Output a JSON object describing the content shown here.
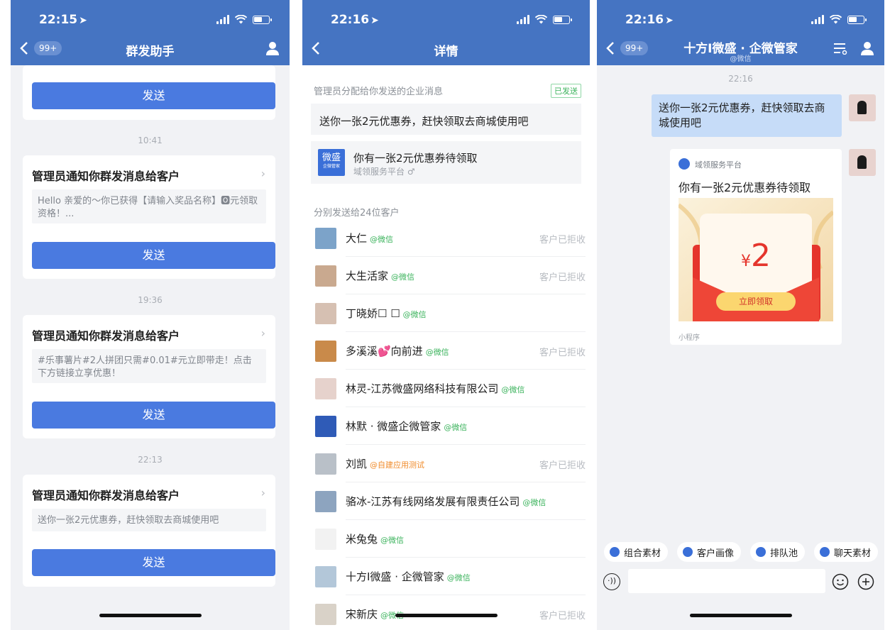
{
  "screen1": {
    "status_time": "22:15",
    "nav_badge": "99+",
    "nav_title": "群发助手",
    "send_label": "发送",
    "items": [
      {
        "time": "10:41",
        "title": "管理员通知你群发消息给客户",
        "preview": "Hello 亲爱的～你已获得【请输入奖品名称】🅾元领取资格！..."
      },
      {
        "time": "19:36",
        "title": "管理员通知你群发消息给客户",
        "preview": "#乐事薯片#2人拼团只需#0.01#元立即带走！点击下方链接立享优惠！"
      },
      {
        "time": "22:13",
        "title": "管理员通知你群发消息给客户",
        "preview": "送你一张2元优惠券，赶快领取去商城使用吧"
      }
    ]
  },
  "screen2": {
    "status_time": "22:16",
    "nav_title": "详情",
    "section_label": "管理员分配给你发送的企业消息",
    "sent_tag": "已发送",
    "message_text": "送你一张2元优惠券，赶快领取去商城使用吧",
    "mini_logo_line1": "微盛",
    "mini_logo_line2": "企微管家",
    "mini_title": "你有一张2元优惠券待领取",
    "mini_source": "域领服务平台",
    "customers_label": "分别发送给24位客户",
    "customers": [
      {
        "name": "大仁",
        "tag": "@微信",
        "status": "客户已拒收"
      },
      {
        "name": "大生活家",
        "tag": "@微信",
        "status": "客户已拒收"
      },
      {
        "name": "丁晓娇☐ ☐",
        "tag": "@微信",
        "status": ""
      },
      {
        "name": "多溪溪💕向前进",
        "tag": "@微信",
        "status": "客户已拒收"
      },
      {
        "name": "林灵-江苏微盛网络科技有限公司",
        "tag": "@微信",
        "status": ""
      },
      {
        "name": "林默 · 微盛企微管家",
        "tag": "@微信",
        "status": ""
      },
      {
        "name": "刘凯",
        "tag": "@自建应用测试",
        "status": "客户已拒收"
      },
      {
        "name": "骆冰-江苏有线网络发展有限责任公司",
        "tag": "@微信",
        "status": ""
      },
      {
        "name": "米兔兔",
        "tag": "@微信",
        "status": ""
      },
      {
        "name": "十方I微盛 · 企微管家",
        "tag": "@微信",
        "status": ""
      },
      {
        "name": "宋新庆",
        "tag": "@微信",
        "status": "客户已拒收"
      }
    ]
  },
  "screen3": {
    "status_time": "22:16",
    "nav_badge": "99+",
    "nav_title": "十方I微盛 · 企微管家",
    "nav_subtitle": "@微信",
    "chat_time": "22:16",
    "bubble_text": "送你一张2元优惠券，赶快领取去商城使用吧",
    "card_source": "域领服务平台",
    "card_title": "你有一张2元优惠券待领取",
    "coupon_amount": "2",
    "coupon_currency": "¥",
    "coupon_button": "立即领取",
    "card_footer": "小程序",
    "quick_actions": [
      "组合素材",
      "客户画像",
      "排队池",
      "聊天素材"
    ]
  },
  "colors": {
    "navbar": "#4574c2",
    "primary_button": "#4a7ae0",
    "tag_green": "#3bb35c",
    "tag_orange": "#f08b2a",
    "bubble": "#c6dcf8"
  }
}
